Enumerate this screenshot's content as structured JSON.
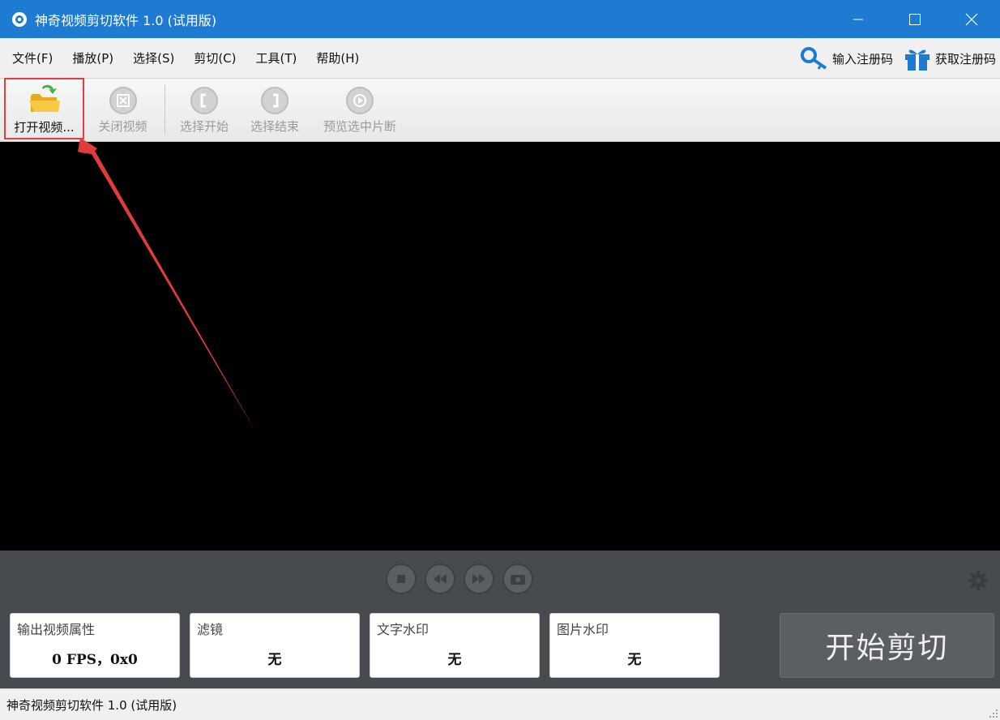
{
  "window": {
    "title": "神奇视频剪切软件 1.0 (试用版)"
  },
  "menu": {
    "items": [
      "文件(F)",
      "播放(P)",
      "选择(S)",
      "剪切(C)",
      "工具(T)",
      "帮助(H)"
    ],
    "enter_code": "输入注册码",
    "get_code": "获取注册码"
  },
  "toolbar": {
    "open_video": "打开视频...",
    "close_video": "关闭视频",
    "select_start": "选择开始",
    "select_end": "选择结束",
    "preview_selection": "预览选中片断"
  },
  "properties": {
    "output": {
      "title": "输出视频属性",
      "value": "0 FPS，0x0"
    },
    "filter": {
      "title": "滤镜",
      "value": "无"
    },
    "text_watermark": {
      "title": "文字水印",
      "value": "无"
    },
    "image_watermark": {
      "title": "图片水印",
      "value": "无"
    }
  },
  "start_button": "开始剪切",
  "status": {
    "text": "神奇视频剪切软件 1.0 (试用版)"
  },
  "colors": {
    "titlebar": "#1e7bd2",
    "video_bg": "#000000",
    "bottom_panel": "#474a4f",
    "highlight": "#e04040"
  },
  "icons": {
    "app": "app-logo-icon",
    "key": "key-icon",
    "gift": "gift-icon",
    "open": "open-folder-icon",
    "close": "close-video-icon",
    "start": "select-start-icon",
    "end": "select-end-icon",
    "preview": "preview-play-icon",
    "settings": "gear-icon"
  }
}
